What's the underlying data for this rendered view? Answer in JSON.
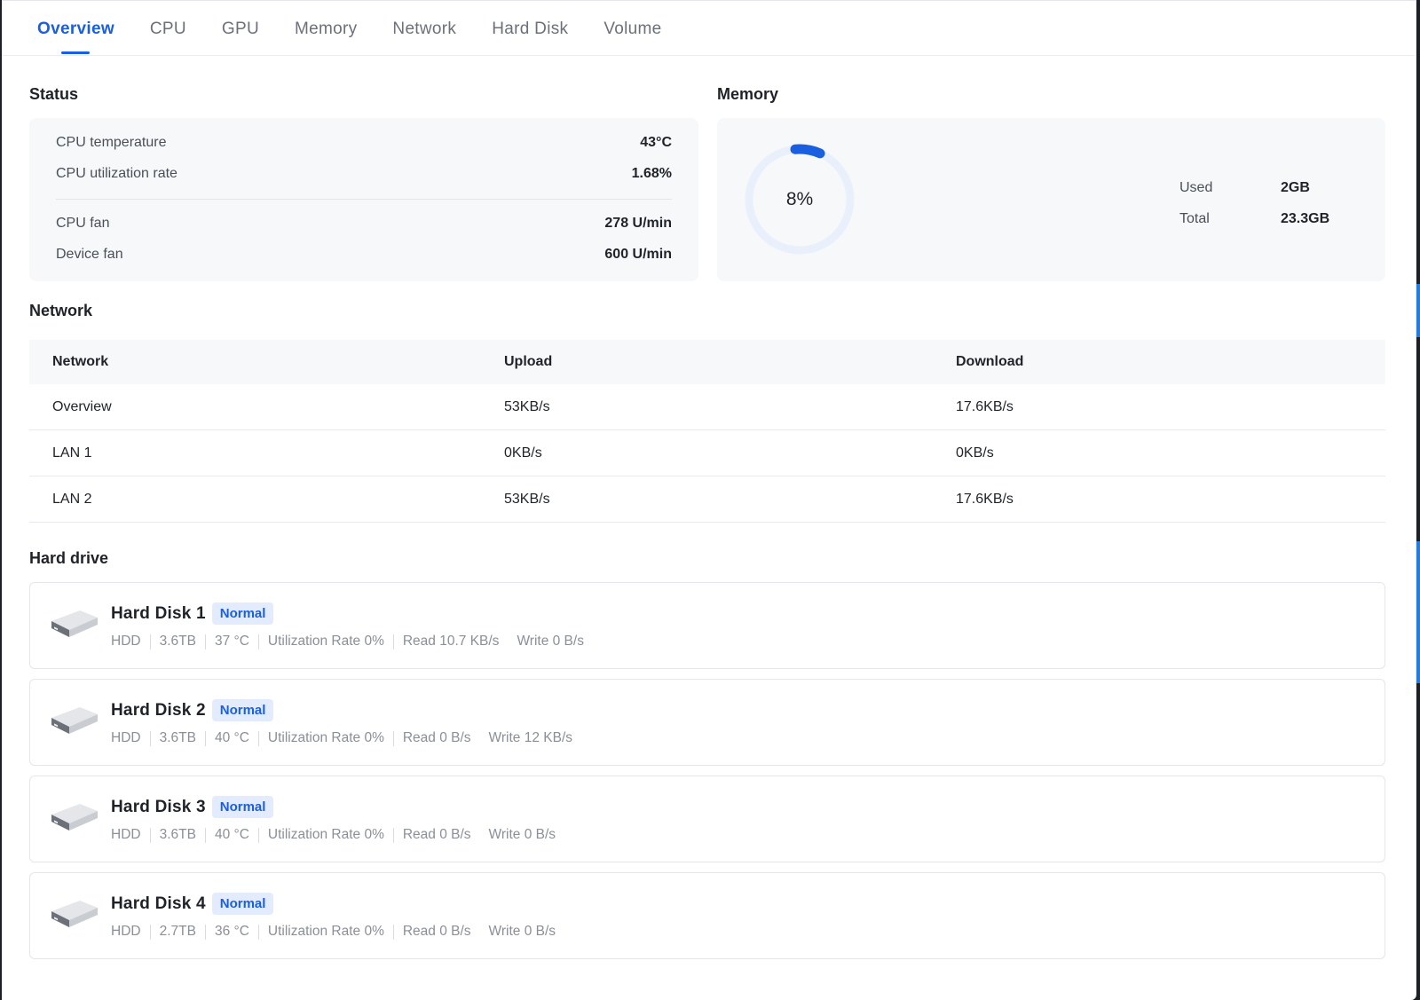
{
  "tabs": [
    {
      "label": "Overview",
      "active": true
    },
    {
      "label": "CPU",
      "active": false
    },
    {
      "label": "GPU",
      "active": false
    },
    {
      "label": "Memory",
      "active": false
    },
    {
      "label": "Network",
      "active": false
    },
    {
      "label": "Hard Disk",
      "active": false
    },
    {
      "label": "Volume",
      "active": false
    }
  ],
  "status": {
    "title": "Status",
    "rows": [
      {
        "label": "CPU temperature",
        "value": "43°C"
      },
      {
        "label": "CPU utilization rate",
        "value": "1.68%"
      },
      {
        "label": "CPU fan",
        "value": "278 U/min"
      },
      {
        "label": "Device fan",
        "value": "600 U/min"
      }
    ]
  },
  "memory": {
    "title": "Memory",
    "percent_label": "8%",
    "percent_value": 0.08,
    "used_label": "Used",
    "used_value": "2GB",
    "total_label": "Total",
    "total_value": "23.3GB"
  },
  "network": {
    "title": "Network",
    "headers": [
      "Network",
      "Upload",
      "Download"
    ],
    "rows": [
      [
        "Overview",
        "53KB/s",
        "17.6KB/s"
      ],
      [
        "LAN 1",
        "0KB/s",
        "0KB/s"
      ],
      [
        "LAN 2",
        "53KB/s",
        "17.6KB/s"
      ]
    ]
  },
  "hard_drive": {
    "title": "Hard drive",
    "disks": [
      {
        "name": "Hard Disk 1",
        "status": "Normal",
        "type": "HDD",
        "capacity": "3.6TB",
        "temp": "37 °C",
        "utilization": "Utilization Rate 0%",
        "read": "Read 10.7 KB/s",
        "write": "Write 0 B/s"
      },
      {
        "name": "Hard Disk 2",
        "status": "Normal",
        "type": "HDD",
        "capacity": "3.6TB",
        "temp": "40 °C",
        "utilization": "Utilization Rate 0%",
        "read": "Read 0 B/s",
        "write": "Write 12 KB/s"
      },
      {
        "name": "Hard Disk 3",
        "status": "Normal",
        "type": "HDD",
        "capacity": "3.6TB",
        "temp": "40 °C",
        "utilization": "Utilization Rate 0%",
        "read": "Read 0 B/s",
        "write": "Write 0 B/s"
      },
      {
        "name": "Hard Disk 4",
        "status": "Normal",
        "type": "HDD",
        "capacity": "2.7TB",
        "temp": "36 °C",
        "utilization": "Utilization Rate 0%",
        "read": "Read 0 B/s",
        "write": "Write 0 B/s"
      }
    ]
  },
  "colors": {
    "accent": "#1a5fe0",
    "ring_track": "#eaf0fb",
    "badge_bg": "#e3ecff"
  }
}
